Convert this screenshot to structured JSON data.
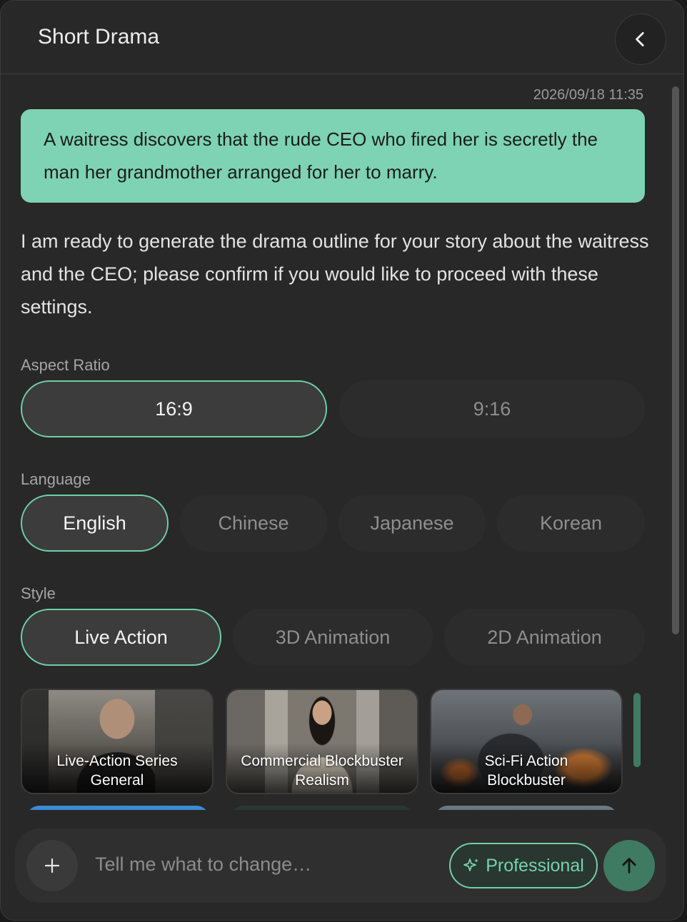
{
  "header": {
    "title": "Short Drama"
  },
  "chat": {
    "timestamp": "2026/09/18 11:35",
    "user_message": "A waitress discovers that the rude CEO who fired her is secretly the man her grandmother arranged for her to marry.",
    "assistant_message": "I am ready to generate the drama outline for your story about the waitress and the CEO; please confirm if you would like to proceed with these settings."
  },
  "settings": {
    "aspect_ratio": {
      "label": "Aspect Ratio",
      "options": [
        "16:9",
        "9:16"
      ],
      "selected": "16:9"
    },
    "language": {
      "label": "Language",
      "options": [
        "English",
        "Chinese",
        "Japanese",
        "Korean"
      ],
      "selected": "English"
    },
    "style": {
      "label": "Style",
      "options": [
        "Live Action",
        "3D Animation",
        "2D Animation"
      ],
      "selected": "Live Action"
    },
    "style_presets": [
      {
        "line1": "Live-Action Series",
        "line2": "General"
      },
      {
        "line1": "Commercial Blockbuster",
        "line2": "Realism"
      },
      {
        "line1": "Sci-Fi Action",
        "line2": "Blockbuster"
      }
    ]
  },
  "composer": {
    "placeholder": "Tell me what to change…",
    "mode_label": "Professional"
  },
  "icons": {
    "back": "chevron-left-icon",
    "plus": "plus-icon",
    "sparkle": "sparkle-icon",
    "send": "arrow-up-icon"
  },
  "colors": {
    "accent": "#6fcfa8",
    "user_bubble": "#7dd3b4",
    "background": "#282828"
  }
}
